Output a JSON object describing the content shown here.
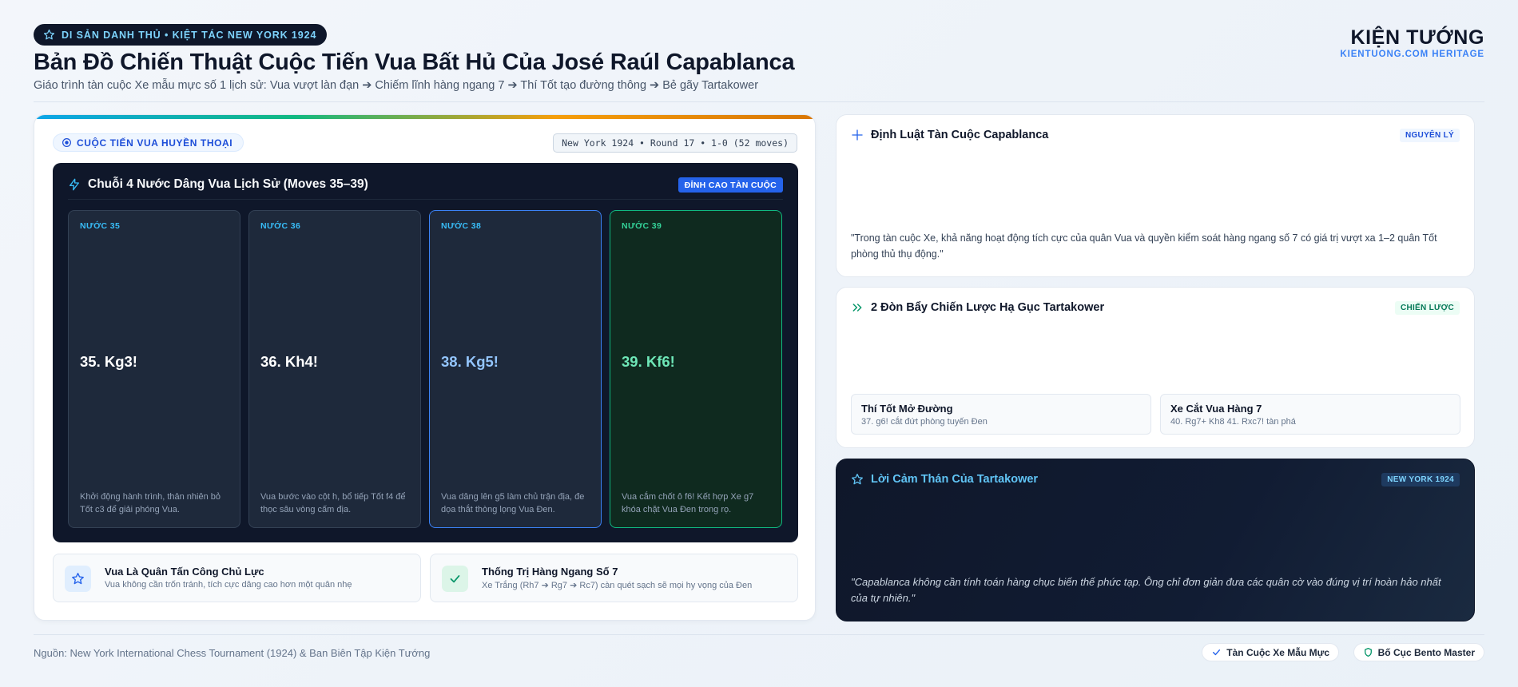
{
  "header": {
    "eyebrow": "DI SẢN DANH THỦ • KIỆT TÁC NEW YORK 1924",
    "title": "Bản Đồ Chiến Thuật Cuộc Tiến Vua Bất Hủ Của José Raúl Capablanca",
    "subtitle": "Giáo trình tàn cuộc Xe mẫu mực số 1 lịch sử: Vua vượt làn đạn ➔ Chiếm lĩnh hàng ngang 7 ➔ Thí Tốt tạo đường thông ➔ Bẻ gãy Tartakower",
    "brand_name": "KIỆN TƯỚNG",
    "brand_sub": "KIENTUONG.COM HERITAGE"
  },
  "main": {
    "pill_label": "CUỘC TIẾN VUA HUYỀN THOẠI",
    "game_meta": "New York 1924 • Round 17 • 1-0 (52 moves)",
    "moves_title": "Chuỗi 4 Nước Dâng Vua Lịch Sử (Moves 35–39)",
    "peak_badge": "ĐỈNH CAO TÀN CUỘC",
    "moves": [
      {
        "step": "NƯỚC 35",
        "san": "35. Kg3!",
        "desc": "Khởi động hành trình, thản nhiên bỏ Tốt c3 để giải phóng Vua."
      },
      {
        "step": "NƯỚC 36",
        "san": "36. Kh4!",
        "desc": "Vua bước vào cột h, bổ tiếp Tốt f4 để thọc sâu vòng cấm địa."
      },
      {
        "step": "NƯỚC 38",
        "san": "38. Kg5!",
        "desc": "Vua dâng lên g5 làm chủ trận địa, đe dọa thắt thòng lọng Vua Đen."
      },
      {
        "step": "NƯỚC 39",
        "san": "39. Kf6!",
        "desc": "Vua cắm chốt ô f6! Kết hợp Xe g7 khóa chặt Vua Đen trong rọ."
      }
    ],
    "features": [
      {
        "title": "Vua Là Quân Tấn Công Chủ Lực",
        "desc": "Vua không cần trốn tránh, tích cực dâng cao hơn một quân nhẹ",
        "icon": "star-icon"
      },
      {
        "title": "Thống Trị Hàng Ngang Số 7",
        "desc": "Xe Trắng (Rh7 ➔ Rg7 ➔ Rc7) càn quét sạch sẽ mọi hy vọng của Đen",
        "icon": "check-icon"
      }
    ]
  },
  "principle": {
    "title": "Định Luật Tàn Cuộc Capablanca",
    "tag": "NGUYÊN LÝ",
    "quote": "\"Trong tàn cuộc Xe, khả năng hoạt động tích cực của quân Vua và quyền kiểm soát hàng ngang số 7 có giá trị vượt xa 1–2 quân Tốt phòng thủ thụ động.\""
  },
  "levers": {
    "title": "2 Đòn Bẩy Chiến Lược Hạ Gục Tartakower",
    "tag": "CHIẾN LƯỢC",
    "items": [
      {
        "title": "Thí Tốt Mở Đường",
        "desc": "37. g6! cắt đứt phòng tuyến Đen"
      },
      {
        "title": "Xe Cắt Vua Hàng 7",
        "desc": "40. Rg7+ Kh8 41. Rxc7! tàn phá"
      }
    ]
  },
  "tribute": {
    "title": "Lời Cảm Thán Của Tartakower",
    "tag": "NEW YORK 1924",
    "quote": "\"Capablanca không cần tính toán hàng chục biến thế phức tạp. Ông chỉ đơn giản đưa các quân cờ vào đúng vị trí hoàn hảo nhất của tự nhiên.\""
  },
  "footer": {
    "source": "Nguồn: New York International Chess Tournament (1924) & Ban Biên Tập Kiện Tướng",
    "chip1": "Tàn Cuộc Xe Mẫu Mực",
    "chip2": "Bố Cục Bento Master"
  },
  "colors": {
    "accent": "#2563eb",
    "dark_panel": "#0f172a",
    "success": "#10b981",
    "sky": "#38bdf8"
  }
}
